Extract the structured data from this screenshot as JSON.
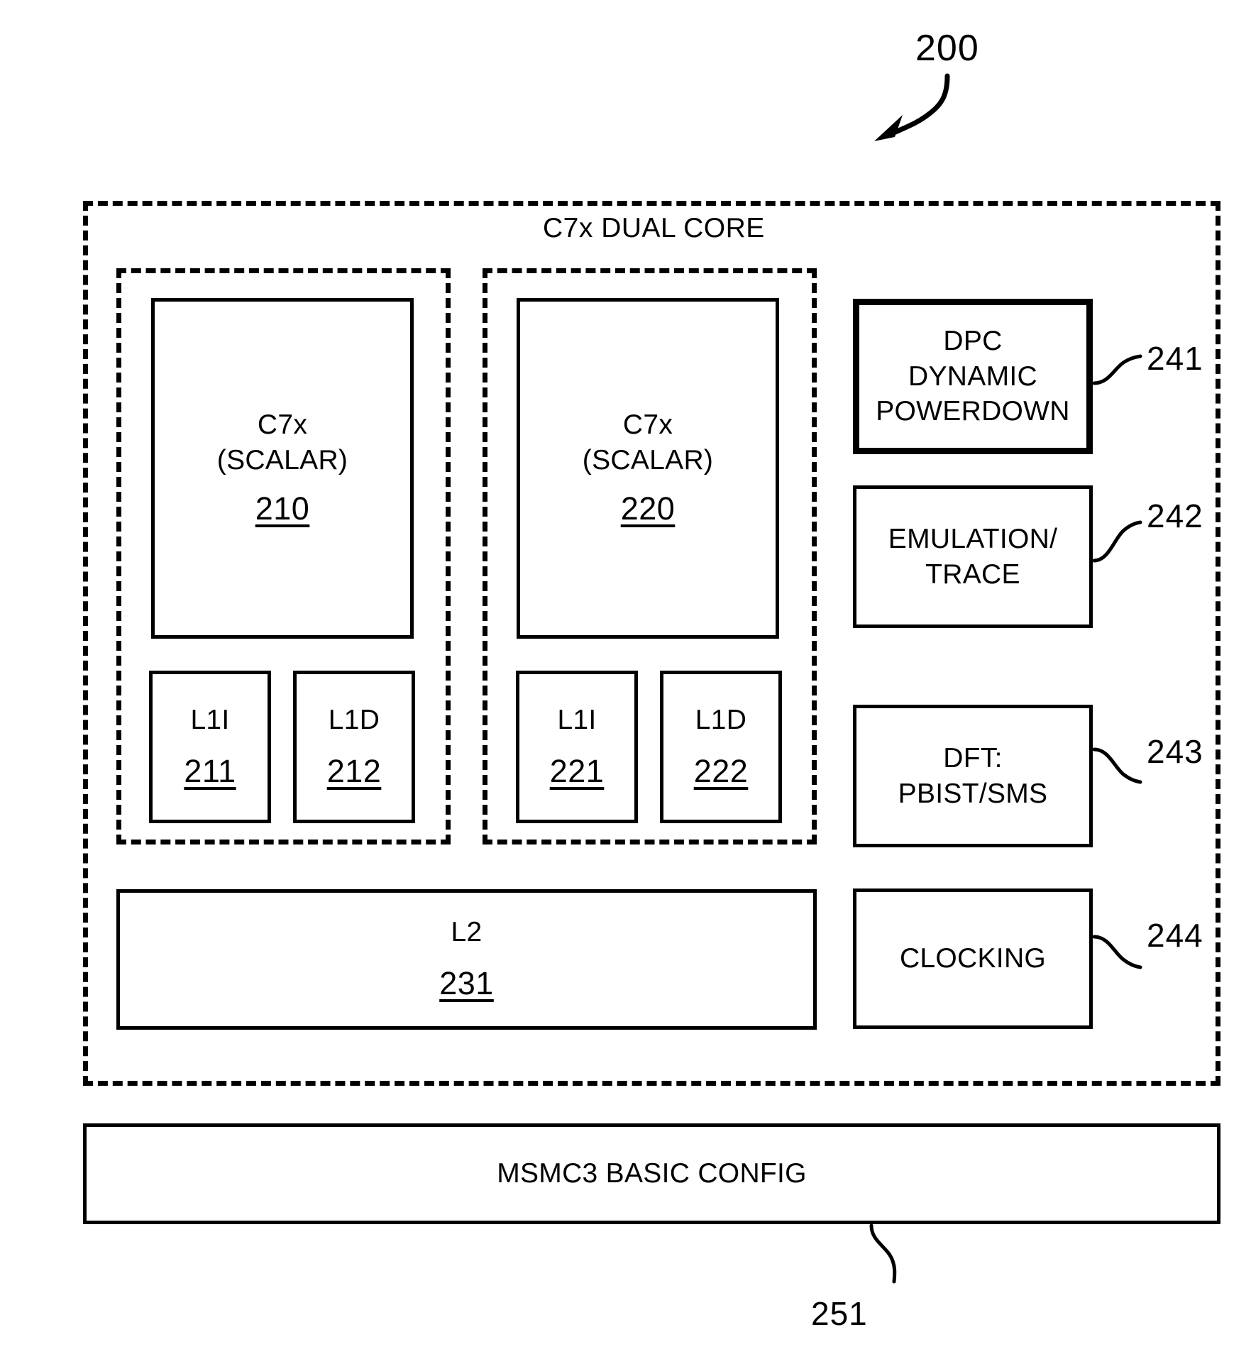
{
  "figure": {
    "number": "200",
    "outer_group_label": "C7x DUAL CORE"
  },
  "cores": [
    {
      "title_line1": "C7x",
      "title_line2": "(SCALAR)",
      "ref": "210",
      "caches": [
        {
          "label": "L1I",
          "ref": "211"
        },
        {
          "label": "L1D",
          "ref": "212"
        }
      ]
    },
    {
      "title_line1": "C7x",
      "title_line2": "(SCALAR)",
      "ref": "220",
      "caches": [
        {
          "label": "L1I",
          "ref": "221"
        },
        {
          "label": "L1D",
          "ref": "222"
        }
      ]
    }
  ],
  "l2": {
    "label": "L2",
    "ref": "231"
  },
  "right_blocks": [
    {
      "lines": [
        "DPC",
        "DYNAMIC",
        "POWERDOWN"
      ],
      "callout": "241",
      "emphasis": "thick"
    },
    {
      "lines": [
        "EMULATION/",
        "TRACE"
      ],
      "callout": "242",
      "emphasis": "normal"
    },
    {
      "lines": [
        "DFT:",
        "PBIST/SMS"
      ],
      "callout": "243",
      "emphasis": "normal"
    },
    {
      "lines": [
        "CLOCKING"
      ],
      "callout": "244",
      "emphasis": "normal"
    }
  ],
  "bottom_bar": {
    "label": "MSMC3 BASIC CONFIG",
    "callout": "251"
  },
  "colors": {
    "line": "#000000",
    "background": "#ffffff"
  }
}
